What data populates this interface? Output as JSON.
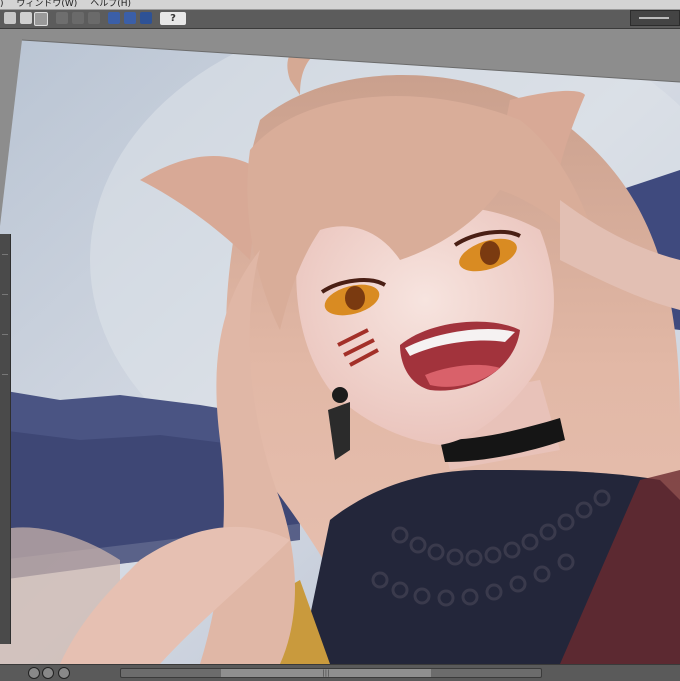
{
  "menubar": {
    "items": [
      ")",
      "ウィンドウ(W)",
      "ヘルプ(H)"
    ]
  },
  "toolbar": {
    "help_label": "?"
  },
  "icons": [
    "layer-icon",
    "pen-icon",
    "transform-icon",
    "mask-icon",
    "ruler-icon",
    "vector-icon",
    "lasso-icon",
    "info-icon"
  ],
  "colors": {
    "toolbar_bg": "#5c5c5c",
    "sky": "#c9d0dc",
    "hair": "#dcae9a",
    "eye": "#d98b22",
    "clothing": "#24263a"
  },
  "status": {
    "scroll_handle": "|||"
  }
}
